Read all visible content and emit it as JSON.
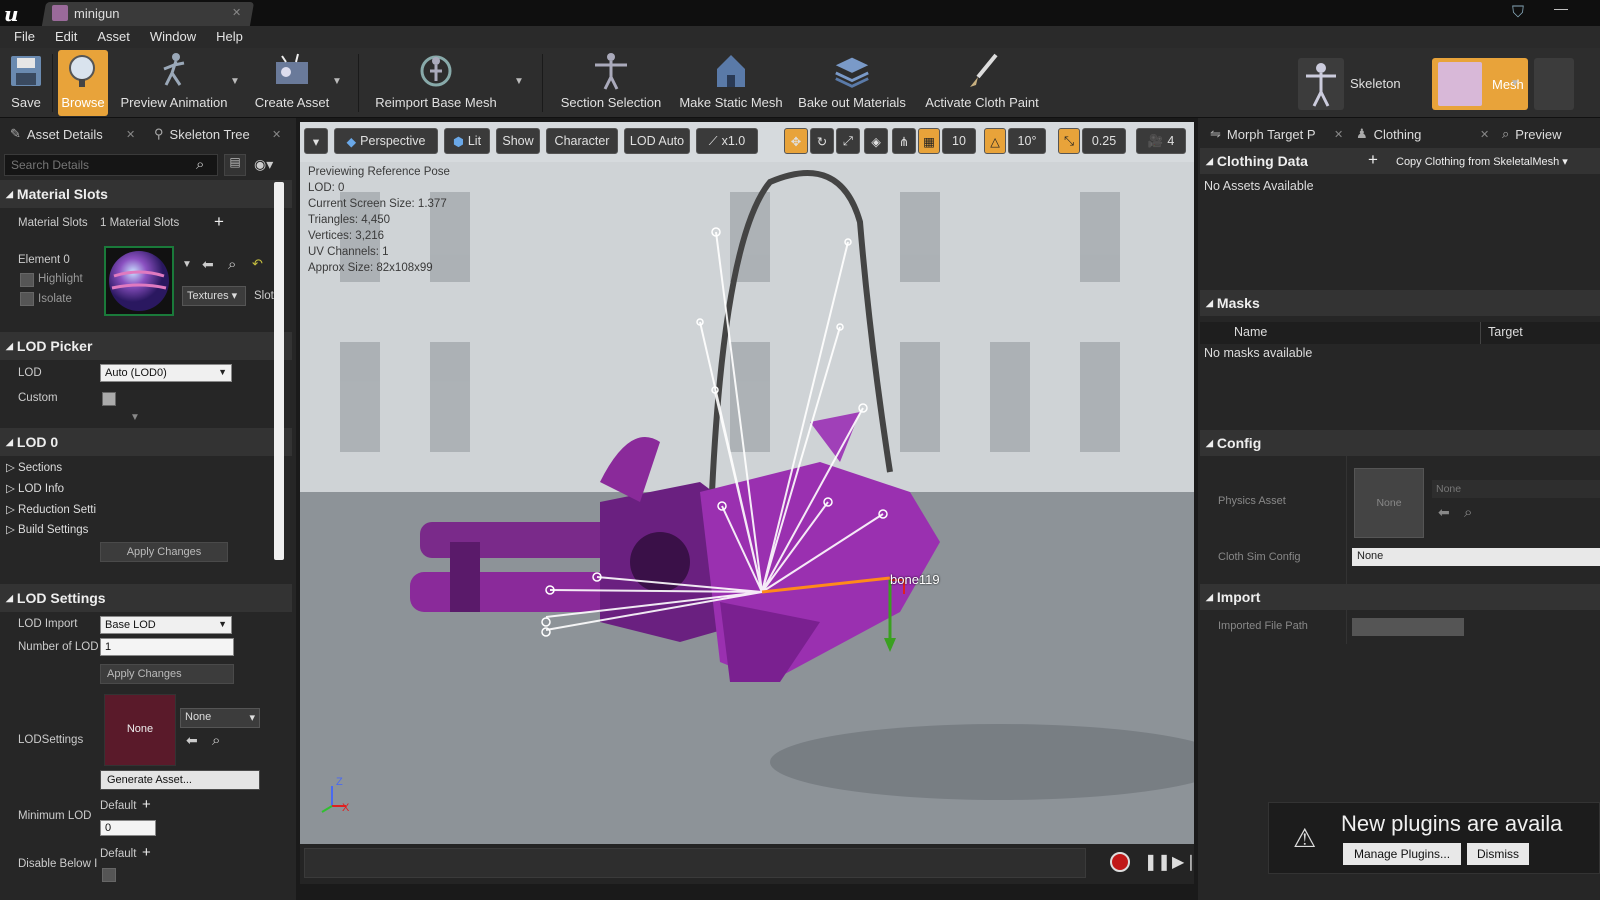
{
  "window": {
    "tab_title": "minigun"
  },
  "menu": [
    "File",
    "Edit",
    "Asset",
    "Window",
    "Help"
  ],
  "toolbar": {
    "save": "Save",
    "browse": "Browse",
    "preview_animation": "Preview Animation",
    "create_asset": "Create Asset",
    "reimport": "Reimport Base Mesh",
    "section_selection": "Section Selection",
    "make_static_mesh": "Make Static Mesh",
    "bake_materials": "Bake out Materials",
    "activate_cloth": "Activate Cloth Paint",
    "skeleton": "Skeleton",
    "mesh": "Mesh"
  },
  "left": {
    "tab_asset_details": "Asset Details",
    "tab_skeleton_tree": "Skeleton Tree",
    "search_placeholder": "Search Details",
    "material_slots_header": "Material Slots",
    "material_slots_label": "Material Slots",
    "material_slots_value": "1 Material Slots",
    "element0": "Element 0",
    "highlight": "Highlight",
    "isolate": "Isolate",
    "textures": "Textures",
    "slot": "Slot",
    "lod_picker_header": "LOD Picker",
    "lod_label": "LOD",
    "lod_value": "Auto (LOD0)",
    "custom_label": "Custom",
    "lod0_header": "LOD 0",
    "tree": [
      "Sections",
      "LOD Info",
      "Reduction Setti",
      "Build Settings"
    ],
    "apply_changes_1": "Apply Changes",
    "lod_settings_header": "LOD Settings",
    "lod_import_label": "LOD Import",
    "lod_import_value": "Base LOD",
    "num_lod_label": "Number of LOD",
    "num_lod_value": "1",
    "apply_changes_2": "Apply Changes",
    "lodsettings_label": "LODSettings",
    "lodsettings_thumb": "None",
    "lodsettings_dropdown": "None",
    "generate_asset": "Generate Asset...",
    "min_lod_label": "Minimum LOD",
    "min_lod_default": "Default",
    "min_lod_value": "0",
    "disable_below_label": "Disable Below I",
    "disable_below_default": "Default"
  },
  "viewport": {
    "perspective": "Perspective",
    "lit": "Lit",
    "show": "Show",
    "character": "Character",
    "lod_auto": "LOD Auto",
    "speed": "x1.0",
    "grid_snap": "10",
    "rot_snap": "10°",
    "scale_snap": "0.25",
    "cam_speed": "4",
    "info": [
      "Previewing Reference Pose",
      "LOD: 0",
      "Current Screen Size: 1.377",
      "Triangles: 4,450",
      "Vertices: 3,216",
      "UV Channels: 1",
      "Approx Size: 82x108x99"
    ],
    "bone_label": "bone119",
    "axis_z": "Z",
    "axis_x": "X"
  },
  "right": {
    "tab_morph": "Morph Target P",
    "tab_clothing": "Clothing",
    "tab_preview": "Preview",
    "clothing_data_header": "Clothing Data",
    "copy_clothing": "Copy Clothing from SkeletalMesh",
    "no_assets": "No Assets Available",
    "masks_header": "Masks",
    "masks_col_name": "Name",
    "masks_col_target": "Target",
    "no_masks": "No masks available",
    "config_header": "Config",
    "physics_asset": "Physics Asset",
    "physics_thumb": "None",
    "physics_value": "None",
    "cloth_sim_config": "Cloth Sim Config",
    "cloth_sim_value": "None",
    "import_header": "Import",
    "imported_file_path": "Imported File Path"
  },
  "notification": {
    "title": "New plugins are availa",
    "manage": "Manage Plugins...",
    "dismiss": "Dismiss"
  },
  "colors": {
    "accent": "#e8a33a",
    "gun_purple": "#8a2a9a"
  }
}
